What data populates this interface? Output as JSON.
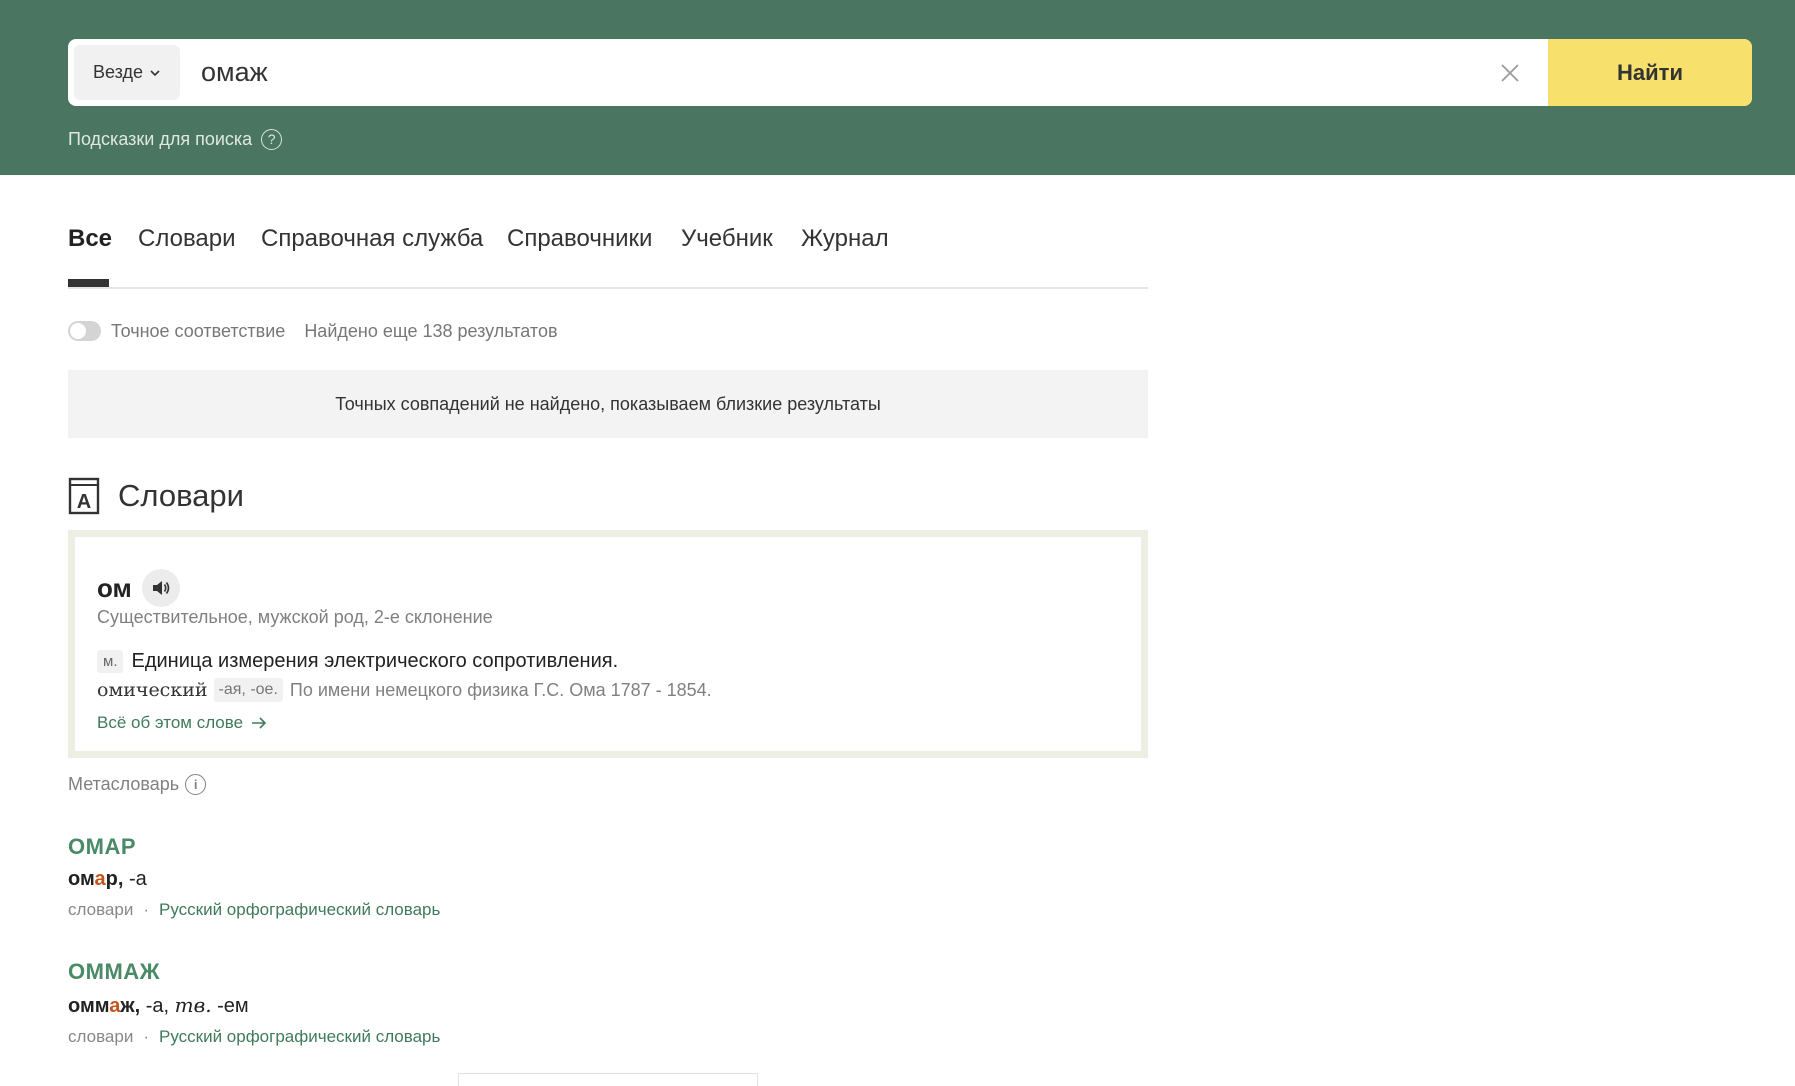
{
  "colors": {
    "header_bg": "#4a7560",
    "find_button": "#f7e06b",
    "link_green": "#3f7a59",
    "accent_orange": "#c4551c"
  },
  "search": {
    "scope_label": "Везде",
    "query": "омаж",
    "find_label": "Найти",
    "hints_label": "Подсказки для поиска",
    "hints_icon": "?"
  },
  "tabs": [
    {
      "label": "Все",
      "active": true
    },
    {
      "label": "Словари",
      "active": false
    },
    {
      "label": "Справочная служба",
      "active": false
    },
    {
      "label": "Справочники",
      "active": false
    },
    {
      "label": "Учебник",
      "active": false
    },
    {
      "label": "Журнал",
      "active": false
    }
  ],
  "filter": {
    "exact_match_label": "Точное соответствие",
    "exact_match_on": false,
    "found_text": "Найдено еще 138 результатов"
  },
  "notice": "Точных совпадений не найдено, показываем близкие результаты",
  "section": {
    "title": "Словари",
    "icon_letter": "A"
  },
  "card": {
    "word": "ом",
    "grammar": "Существительное, мужской род, 2-е склонение",
    "definition_tag": "м.",
    "definition": "Единица измерения электрического сопротивления.",
    "derivative_word": "омический",
    "derivative_forms": "-ая, -ое.",
    "etymology": "По имени немецкого физика Г.С. Ома 1787 - 1854.",
    "more_link": "Всё об этом слове"
  },
  "metaslovar": {
    "label": "Метасловарь",
    "info_icon": "i"
  },
  "results": [
    {
      "title": "ОМАР",
      "stem_before": "ом",
      "stem_accent": "а",
      "stem_after": "р,",
      "forms": " -а",
      "category": "словари",
      "separator": "·",
      "source": "Русский орфографический словарь"
    },
    {
      "title": "ОММАЖ",
      "stem_before": "омм",
      "stem_accent": "а",
      "stem_after": "ж,",
      "forms": " -а,",
      "case_abbr": "тв.",
      "forms_after": " -ем",
      "category": "словари",
      "separator": "·",
      "source": "Русский орфографический словарь"
    }
  ]
}
